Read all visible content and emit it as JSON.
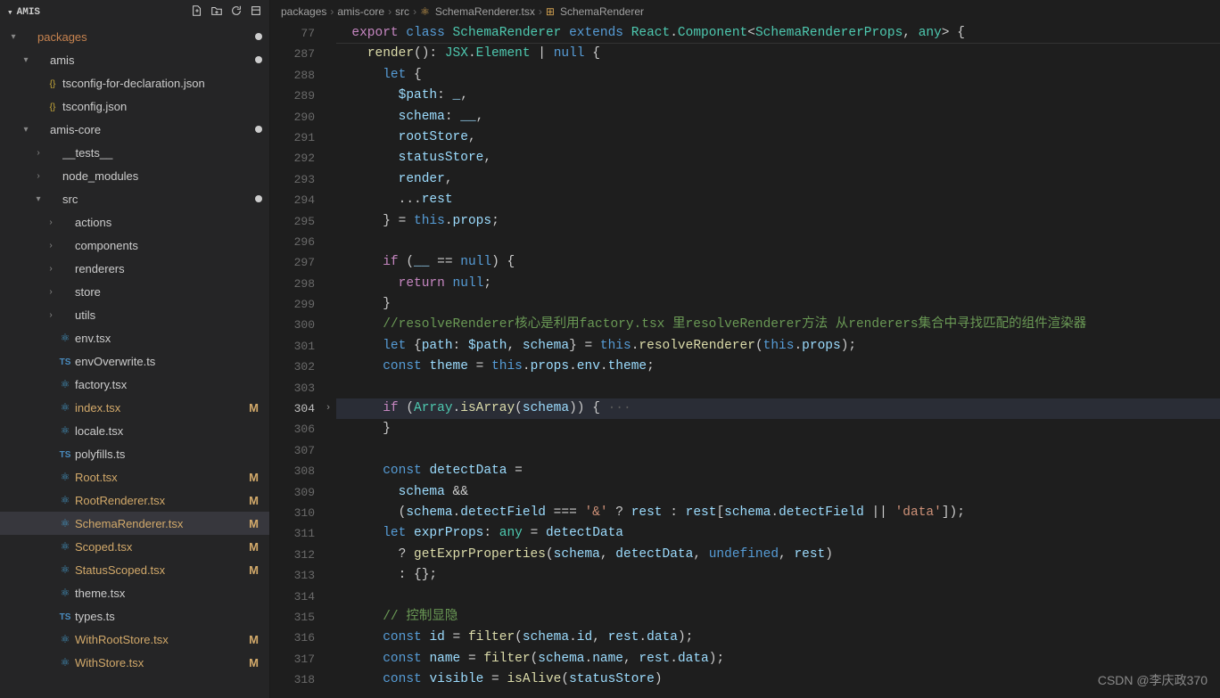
{
  "sidebar": {
    "title": "AMIS",
    "items": [
      {
        "indent": 0,
        "chev": "▾",
        "kind": "folder",
        "label": "packages",
        "cls": "packages-txt",
        "dot": true
      },
      {
        "indent": 1,
        "chev": "▾",
        "kind": "folder",
        "label": "amis",
        "dot": true
      },
      {
        "indent": 2,
        "chev": "",
        "kind": "json",
        "label": "tsconfig-for-declaration.json"
      },
      {
        "indent": 2,
        "chev": "",
        "kind": "json",
        "label": "tsconfig.json"
      },
      {
        "indent": 1,
        "chev": "▾",
        "kind": "folder",
        "label": "amis-core",
        "dot": true
      },
      {
        "indent": 2,
        "chev": "›",
        "kind": "folder",
        "label": "__tests__"
      },
      {
        "indent": 2,
        "chev": "›",
        "kind": "folder",
        "label": "node_modules"
      },
      {
        "indent": 2,
        "chev": "▾",
        "kind": "folder",
        "label": "src",
        "dot": true
      },
      {
        "indent": 3,
        "chev": "›",
        "kind": "folder",
        "label": "actions"
      },
      {
        "indent": 3,
        "chev": "›",
        "kind": "folder",
        "label": "components"
      },
      {
        "indent": 3,
        "chev": "›",
        "kind": "folder",
        "label": "renderers"
      },
      {
        "indent": 3,
        "chev": "›",
        "kind": "folder",
        "label": "store"
      },
      {
        "indent": 3,
        "chev": "›",
        "kind": "folder",
        "label": "utils"
      },
      {
        "indent": 3,
        "chev": "",
        "kind": "react",
        "label": "env.tsx"
      },
      {
        "indent": 3,
        "chev": "",
        "kind": "ts",
        "label": "envOverwrite.ts"
      },
      {
        "indent": 3,
        "chev": "",
        "kind": "react",
        "label": "factory.tsx"
      },
      {
        "indent": 3,
        "chev": "",
        "kind": "react",
        "label": "index.tsx",
        "m": true
      },
      {
        "indent": 3,
        "chev": "",
        "kind": "react",
        "label": "locale.tsx"
      },
      {
        "indent": 3,
        "chev": "",
        "kind": "ts",
        "label": "polyfills.ts"
      },
      {
        "indent": 3,
        "chev": "",
        "kind": "react",
        "label": "Root.tsx",
        "m": true
      },
      {
        "indent": 3,
        "chev": "",
        "kind": "react",
        "label": "RootRenderer.tsx",
        "m": true
      },
      {
        "indent": 3,
        "chev": "",
        "kind": "react",
        "label": "SchemaRenderer.tsx",
        "m": true,
        "active": true
      },
      {
        "indent": 3,
        "chev": "",
        "kind": "react",
        "label": "Scoped.tsx",
        "m": true
      },
      {
        "indent": 3,
        "chev": "",
        "kind": "react",
        "label": "StatusScoped.tsx",
        "m": true
      },
      {
        "indent": 3,
        "chev": "",
        "kind": "react",
        "label": "theme.tsx"
      },
      {
        "indent": 3,
        "chev": "",
        "kind": "ts",
        "label": "types.ts"
      },
      {
        "indent": 3,
        "chev": "",
        "kind": "react",
        "label": "WithRootStore.tsx",
        "m": true
      },
      {
        "indent": 3,
        "chev": "",
        "kind": "react",
        "label": "WithStore.tsx",
        "m": true
      }
    ]
  },
  "breadcrumb": [
    "packages",
    "amis-core",
    "src",
    "SchemaRenderer.tsx",
    "SchemaRenderer"
  ],
  "gutter": {
    "sticky": "77",
    "lines": [
      "287",
      "288",
      "289",
      "290",
      "291",
      "292",
      "293",
      "294",
      "295",
      "296",
      "297",
      "298",
      "299",
      "300",
      "301",
      "302",
      "303",
      "304",
      "306",
      "307",
      "308",
      "309",
      "310",
      "311",
      "312",
      "313",
      "314",
      "315",
      "316",
      "317",
      "318"
    ],
    "highlight": "304",
    "fold_at": "304"
  },
  "code": {
    "sticky_tokens": [
      [
        "kw2",
        "export "
      ],
      [
        "kw",
        "class "
      ],
      [
        "type",
        "SchemaRenderer "
      ],
      [
        "kw",
        "extends "
      ],
      [
        "type",
        "React"
      ],
      [
        "pun",
        "."
      ],
      [
        "type",
        "Component"
      ],
      [
        "pun",
        "<"
      ],
      [
        "type",
        "SchemaRendererProps"
      ],
      [
        "pun",
        ", "
      ],
      [
        "type",
        "any"
      ],
      [
        "pun",
        "> {"
      ]
    ],
    "lines": [
      {
        "n": "287",
        "ind": 4,
        "t": [
          [
            "fn",
            "render"
          ],
          [
            "pun",
            "(): "
          ],
          [
            "type",
            "JSX"
          ],
          [
            "pun",
            "."
          ],
          [
            "type",
            "Element"
          ],
          [
            "pun",
            " | "
          ],
          [
            "null",
            "null"
          ],
          [
            "pun",
            " {"
          ]
        ]
      },
      {
        "n": "288",
        "ind": 6,
        "t": [
          [
            "kw",
            "let "
          ],
          [
            "pun",
            "{"
          ]
        ]
      },
      {
        "n": "289",
        "ind": 8,
        "t": [
          [
            "var",
            "$path"
          ],
          [
            "pun",
            ": "
          ],
          [
            "var",
            "_"
          ],
          [
            "pun",
            ","
          ]
        ]
      },
      {
        "n": "290",
        "ind": 8,
        "t": [
          [
            "var",
            "schema"
          ],
          [
            "pun",
            ": "
          ],
          [
            "var",
            "__"
          ],
          [
            "pun",
            ","
          ]
        ]
      },
      {
        "n": "291",
        "ind": 8,
        "t": [
          [
            "var",
            "rootStore"
          ],
          [
            "pun",
            ","
          ]
        ]
      },
      {
        "n": "292",
        "ind": 8,
        "t": [
          [
            "var",
            "statusStore"
          ],
          [
            "pun",
            ","
          ]
        ]
      },
      {
        "n": "293",
        "ind": 8,
        "t": [
          [
            "var",
            "render"
          ],
          [
            "pun",
            ","
          ]
        ]
      },
      {
        "n": "294",
        "ind": 8,
        "t": [
          [
            "pun",
            "..."
          ],
          [
            "var",
            "rest"
          ]
        ]
      },
      {
        "n": "295",
        "ind": 6,
        "t": [
          [
            "pun",
            "} = "
          ],
          [
            "kw",
            "this"
          ],
          [
            "pun",
            "."
          ],
          [
            "var",
            "props"
          ],
          [
            "pun",
            ";"
          ]
        ]
      },
      {
        "n": "296",
        "ind": 0,
        "t": [
          [
            "pun",
            ""
          ]
        ]
      },
      {
        "n": "297",
        "ind": 6,
        "t": [
          [
            "kw2",
            "if "
          ],
          [
            "pun",
            "("
          ],
          [
            "var",
            "__"
          ],
          [
            "pun",
            " == "
          ],
          [
            "null",
            "null"
          ],
          [
            "pun",
            ") {"
          ]
        ]
      },
      {
        "n": "298",
        "ind": 8,
        "t": [
          [
            "kw2",
            "return "
          ],
          [
            "null",
            "null"
          ],
          [
            "pun",
            ";"
          ]
        ]
      },
      {
        "n": "299",
        "ind": 6,
        "t": [
          [
            "pun",
            "}"
          ]
        ]
      },
      {
        "n": "300",
        "ind": 6,
        "t": [
          [
            "cmt",
            "//resolveRenderer核心是利用factory.tsx 里resolveRenderer方法 从renderers集合中寻找匹配的组件渲染器"
          ]
        ]
      },
      {
        "n": "301",
        "ind": 6,
        "t": [
          [
            "kw",
            "let "
          ],
          [
            "pun",
            "{"
          ],
          [
            "var",
            "path"
          ],
          [
            "pun",
            ": "
          ],
          [
            "var",
            "$path"
          ],
          [
            "pun",
            ", "
          ],
          [
            "var",
            "schema"
          ],
          [
            "pun",
            "} = "
          ],
          [
            "kw",
            "this"
          ],
          [
            "pun",
            "."
          ],
          [
            "fn",
            "resolveRenderer"
          ],
          [
            "pun",
            "("
          ],
          [
            "kw",
            "this"
          ],
          [
            "pun",
            "."
          ],
          [
            "var",
            "props"
          ],
          [
            "pun",
            ");"
          ]
        ]
      },
      {
        "n": "302",
        "ind": 6,
        "t": [
          [
            "kw",
            "const "
          ],
          [
            "var",
            "theme"
          ],
          [
            "pun",
            " = "
          ],
          [
            "kw",
            "this"
          ],
          [
            "pun",
            "."
          ],
          [
            "var",
            "props"
          ],
          [
            "pun",
            "."
          ],
          [
            "var",
            "env"
          ],
          [
            "pun",
            "."
          ],
          [
            "var",
            "theme"
          ],
          [
            "pun",
            ";"
          ]
        ]
      },
      {
        "n": "303",
        "ind": 0,
        "t": [
          [
            "pun",
            ""
          ]
        ]
      },
      {
        "n": "304",
        "ind": 6,
        "hl": true,
        "t": [
          [
            "kw2",
            "if "
          ],
          [
            "pun",
            "("
          ],
          [
            "type",
            "Array"
          ],
          [
            "pun",
            "."
          ],
          [
            "fn",
            "isArray"
          ],
          [
            "pun",
            "("
          ],
          [
            "var",
            "schema"
          ],
          [
            "pun",
            ")) {"
          ],
          [
            "dots",
            " ···"
          ]
        ]
      },
      {
        "n": "306",
        "ind": 6,
        "t": [
          [
            "pun",
            "}"
          ]
        ]
      },
      {
        "n": "307",
        "ind": 0,
        "t": [
          [
            "pun",
            ""
          ]
        ]
      },
      {
        "n": "308",
        "ind": 6,
        "t": [
          [
            "kw",
            "const "
          ],
          [
            "var",
            "detectData"
          ],
          [
            "pun",
            " ="
          ]
        ]
      },
      {
        "n": "309",
        "ind": 8,
        "t": [
          [
            "var",
            "schema"
          ],
          [
            "pun",
            " &&"
          ]
        ]
      },
      {
        "n": "310",
        "ind": 8,
        "t": [
          [
            "pun",
            "("
          ],
          [
            "var",
            "schema"
          ],
          [
            "pun",
            "."
          ],
          [
            "var",
            "detectField"
          ],
          [
            "pun",
            " === "
          ],
          [
            "str",
            "'&'"
          ],
          [
            "pun",
            " ? "
          ],
          [
            "var",
            "rest"
          ],
          [
            "pun",
            " : "
          ],
          [
            "var",
            "rest"
          ],
          [
            "pun",
            "["
          ],
          [
            "var",
            "schema"
          ],
          [
            "pun",
            "."
          ],
          [
            "var",
            "detectField"
          ],
          [
            "pun",
            " || "
          ],
          [
            "str",
            "'data'"
          ],
          [
            "pun",
            "]);"
          ]
        ]
      },
      {
        "n": "311",
        "ind": 6,
        "t": [
          [
            "kw",
            "let "
          ],
          [
            "var",
            "exprProps"
          ],
          [
            "pun",
            ": "
          ],
          [
            "type",
            "any"
          ],
          [
            "pun",
            " = "
          ],
          [
            "var",
            "detectData"
          ]
        ]
      },
      {
        "n": "312",
        "ind": 8,
        "t": [
          [
            "pun",
            "? "
          ],
          [
            "fn",
            "getExprProperties"
          ],
          [
            "pun",
            "("
          ],
          [
            "var",
            "schema"
          ],
          [
            "pun",
            ", "
          ],
          [
            "var",
            "detectData"
          ],
          [
            "pun",
            ", "
          ],
          [
            "null",
            "undefined"
          ],
          [
            "pun",
            ", "
          ],
          [
            "var",
            "rest"
          ],
          [
            "pun",
            ")"
          ]
        ]
      },
      {
        "n": "313",
        "ind": 8,
        "t": [
          [
            "pun",
            ": {};"
          ]
        ]
      },
      {
        "n": "314",
        "ind": 0,
        "t": [
          [
            "pun",
            ""
          ]
        ]
      },
      {
        "n": "315",
        "ind": 6,
        "t": [
          [
            "cmt",
            "// 控制显隐"
          ]
        ]
      },
      {
        "n": "316",
        "ind": 6,
        "t": [
          [
            "kw",
            "const "
          ],
          [
            "var",
            "id"
          ],
          [
            "pun",
            " = "
          ],
          [
            "fn",
            "filter"
          ],
          [
            "pun",
            "("
          ],
          [
            "var",
            "schema"
          ],
          [
            "pun",
            "."
          ],
          [
            "var",
            "id"
          ],
          [
            "pun",
            ", "
          ],
          [
            "var",
            "rest"
          ],
          [
            "pun",
            "."
          ],
          [
            "var",
            "data"
          ],
          [
            "pun",
            ");"
          ]
        ]
      },
      {
        "n": "317",
        "ind": 6,
        "t": [
          [
            "kw",
            "const "
          ],
          [
            "var",
            "name"
          ],
          [
            "pun",
            " = "
          ],
          [
            "fn",
            "filter"
          ],
          [
            "pun",
            "("
          ],
          [
            "var",
            "schema"
          ],
          [
            "pun",
            "."
          ],
          [
            "var",
            "name"
          ],
          [
            "pun",
            ", "
          ],
          [
            "var",
            "rest"
          ],
          [
            "pun",
            "."
          ],
          [
            "var",
            "data"
          ],
          [
            "pun",
            ");"
          ]
        ]
      },
      {
        "n": "318",
        "ind": 6,
        "t": [
          [
            "kw",
            "const "
          ],
          [
            "var",
            "visible"
          ],
          [
            "pun",
            " = "
          ],
          [
            "fn",
            "isAlive"
          ],
          [
            "pun",
            "("
          ],
          [
            "var",
            "statusStore"
          ],
          [
            "pun",
            ")"
          ]
        ]
      }
    ]
  },
  "watermark": "CSDN @李庆政370"
}
